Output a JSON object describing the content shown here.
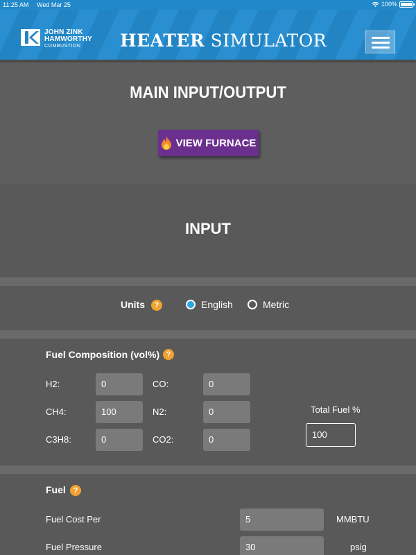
{
  "status": {
    "time": "11:25 AM",
    "date": "Wed Mar 25",
    "battery": "100%"
  },
  "header": {
    "logo_line1": "JOHN ZINK",
    "logo_line2": "HAMWORTHY",
    "logo_line3": "COMBUSTION",
    "title_bold": "HEATER",
    "title_rest": " SIMULATOR",
    "brand_color": "#2a8fd0"
  },
  "main": {
    "title": "MAIN INPUT/OUTPUT",
    "view_furnace": "VIEW FURNACE",
    "button_color": "#6b2f8e"
  },
  "input": {
    "heading": "INPUT"
  },
  "units": {
    "label": "Units",
    "options": [
      "English",
      "Metric"
    ],
    "selected": "English"
  },
  "fuel_composition": {
    "title": "Fuel Composition (vol%)",
    "rows": [
      {
        "label": "H2:",
        "value": "0"
      },
      {
        "label": "CH4:",
        "value": "100"
      },
      {
        "label": "C3H8:",
        "value": "0"
      },
      {
        "label": "CO:",
        "value": "0"
      },
      {
        "label": "N2:",
        "value": "0"
      },
      {
        "label": "CO2:",
        "value": "0"
      }
    ],
    "total_label": "Total Fuel %",
    "total_value": "100"
  },
  "fuel": {
    "title": "Fuel",
    "cost_label": "Fuel Cost Per",
    "cost_value": "5",
    "cost_unit": "MMBTU",
    "pressure_label": "Fuel Pressure",
    "pressure_value": "30",
    "pressure_unit": "psig"
  },
  "help_glyph": "?"
}
